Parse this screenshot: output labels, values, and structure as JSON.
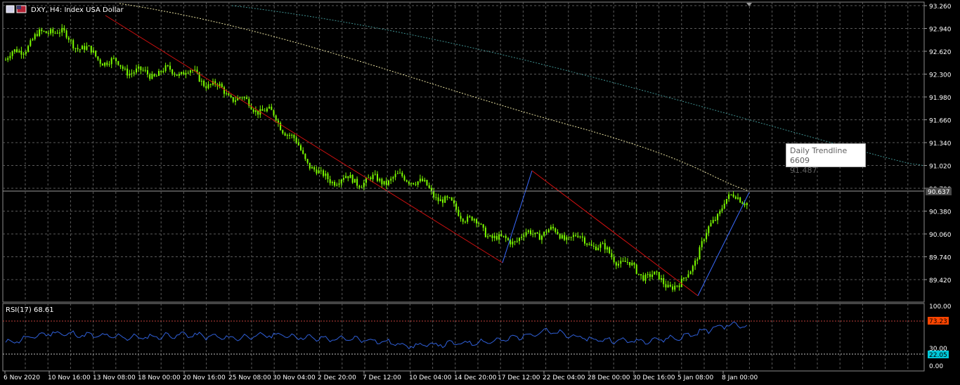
{
  "header": {
    "symbol_title": "DXY, H4:  Index USA Dollar"
  },
  "tooltip": {
    "line1": "Daily Trendline 6609",
    "line2": "91.487"
  },
  "price_axis": {
    "labels": [
      "93.260",
      "92.940",
      "92.620",
      "92.300",
      "91.980",
      "91.660",
      "91.340",
      "91.020",
      "90.700",
      "90.380",
      "90.060",
      "89.740",
      "89.420"
    ],
    "current_price": "90.637"
  },
  "rsi_panel": {
    "title": "RSI(17) 68.61",
    "scale_labels": [
      "100.00",
      "30.00",
      "0.00"
    ],
    "upper_badge": "73.23",
    "lower_badge": "22.05"
  },
  "time_axis": {
    "labels": [
      "6 Nov 2020",
      "10 Nov 16:00",
      "13 Nov 08:00",
      "18 Nov 00:00",
      "20 Nov 16:00",
      "25 Nov 08:00",
      "30 Nov 04:00",
      "2 Dec 20:00",
      "7 Dec 12:00",
      "10 Dec 04:00",
      "14 Dec 20:00",
      "17 Dec 12:00",
      "22 Dec 04:00",
      "28 Dec 00:00",
      "30 Dec 16:00",
      "5 Jan 08:00",
      "8 Jan 00:00"
    ]
  },
  "colors": {
    "background": "#000000",
    "grid": "#5a5a5a",
    "bar_up": "#7CFC00",
    "trend_red": "#d01010",
    "trend_blue": "#3a6bff",
    "ma_yellow": "#e8e0a0",
    "ma_teal": "#3f8f8f",
    "rsi_line": "#2f5fd8",
    "badge_red": "#ff4500",
    "badge_cyan": "#00c8d8"
  },
  "chart_data": {
    "type": "line",
    "title": "DXY, H4:  Index USA Dollar",
    "xlabel": "",
    "ylabel": "",
    "ylim": [
      89.1,
      93.32
    ],
    "x": [
      "6 Nov 2020",
      "10 Nov 16:00",
      "13 Nov 08:00",
      "18 Nov 00:00",
      "20 Nov 16:00",
      "25 Nov 08:00",
      "30 Nov 04:00",
      "2 Dec 20:00",
      "7 Dec 12:00",
      "10 Dec 04:00",
      "14 Dec 20:00",
      "17 Dec 12:00",
      "22 Dec 04:00",
      "28 Dec 00:00",
      "30 Dec 16:00",
      "5 Jan 08:00",
      "8 Jan 00:00"
    ],
    "series": [
      {
        "values": [
          92.5,
          92.95,
          92.55,
          92.3,
          92.35,
          92.0,
          91.7,
          90.85,
          90.8,
          90.85,
          90.4,
          89.95,
          90.1,
          89.95,
          89.55,
          89.3,
          90.55
        ]
      }
    ],
    "rsi": {
      "name": "RSI(17)",
      "ylim": [
        0,
        100
      ],
      "levels": [
        73.23,
        22.05
      ],
      "values": [
        38,
        55,
        50,
        47,
        52,
        46,
        52,
        45,
        44,
        33,
        37,
        42,
        58,
        44,
        41,
        47,
        68
      ]
    },
    "grid": true
  }
}
